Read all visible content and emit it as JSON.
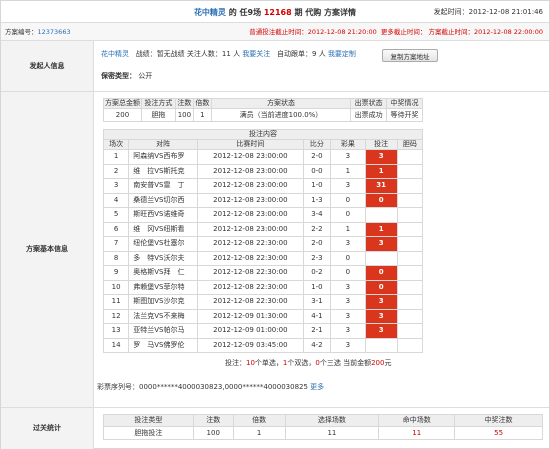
{
  "header": {
    "title_prefix": "花中精灵",
    "title_mid": " 的 任9场 ",
    "issue": "12168",
    "title_suffix": " 期 代购 方案详情",
    "publish_label": "发起时间：",
    "publish_time": "2012-12-08 21:01:46",
    "deadline_normal_label": "普通投注截止时间：",
    "deadline_normal": "2012-12-08 21:20:00",
    "deadline_more_label": "更多截止时间：",
    "deadline_final_label": "方案截止时间：",
    "deadline_final": "2012-12-08 22:00:00"
  },
  "scheme": {
    "id_label": "方案编号：",
    "id": "12373663"
  },
  "initiator": {
    "section_label": "发起人信息",
    "name": "花中精灵",
    "record_label": "战绩：",
    "record": "暂无战绩",
    "followers_label": " 关注人数：",
    "followers": "11",
    "followers_unit": " 人",
    "follow_link": "我要关注",
    "auto_label": "自动跟单：",
    "auto_count": "9",
    "auto_unit": " 人",
    "auto_link": "我要定制",
    "copy_button": "复制方案地址",
    "promo_label": "保密类型：",
    "promo_value": "公开"
  },
  "basic": {
    "section_label": "方案基本信息",
    "summary_headers": [
      "方案总金额",
      "投注方式",
      "注数",
      "倍数",
      "方案状态",
      "出票状态",
      "中奖情况"
    ],
    "summary_row": [
      "200",
      "胆拖",
      "100",
      "1",
      "满员（当前进度100.0%）",
      "出票成功",
      "等待开奖"
    ],
    "bet_title": "投注内容",
    "bet_headers": [
      "场次",
      "对阵",
      "比赛时间",
      "比分",
      "彩果",
      "投注",
      "胆码"
    ],
    "rows": [
      [
        "1",
        "阿森纳VS西布罗",
        "2012-12-08 23:00:00",
        "2-0",
        "3",
        "3",
        ""
      ],
      [
        "2",
        "维　拉VS斯托克",
        "2012-12-08 23:00:00",
        "0-0",
        "1",
        "1",
        ""
      ],
      [
        "3",
        "南安普VS雷　丁",
        "2012-12-08 23:00:00",
        "1-0",
        "3",
        "31",
        ""
      ],
      [
        "4",
        "桑德兰VS切尔西",
        "2012-12-08 23:00:00",
        "1-3",
        "0",
        "0",
        ""
      ],
      [
        "5",
        "斯旺西VS诺维奇",
        "2012-12-08 23:00:00",
        "3-4",
        "0",
        "",
        ""
      ],
      [
        "6",
        "维　冈VS纽斯看",
        "2012-12-08 23:00:00",
        "2-2",
        "1",
        "1",
        ""
      ],
      [
        "7",
        "纽伦堡VS杜塞尔",
        "2012-12-08 22:30:00",
        "2-0",
        "3",
        "3",
        ""
      ],
      [
        "8",
        "多　特VS沃尔夫",
        "2012-12-08 22:30:00",
        "2-3",
        "0",
        "",
        ""
      ],
      [
        "9",
        "奥格斯VS拜　仁",
        "2012-12-08 22:30:00",
        "0-2",
        "0",
        "0",
        ""
      ],
      [
        "10",
        "弗赖堡VS菲尔特",
        "2012-12-08 22:30:00",
        "1-0",
        "3",
        "0",
        ""
      ],
      [
        "11",
        "斯图加VS沙尔克",
        "2012-12-08 22:30:00",
        "3-1",
        "3",
        "3",
        ""
      ],
      [
        "12",
        "法兰克VS不来梅",
        "2012-12-09 01:30:00",
        "4-1",
        "3",
        "3",
        ""
      ],
      [
        "13",
        "亚特兰VS帕尔马",
        "2012-12-09 01:00:00",
        "2-1",
        "3",
        "3",
        ""
      ],
      [
        "14",
        "罗　马VS佛罗伦",
        "2012-12-09 03:45:00",
        "4-2",
        "3",
        "",
        ""
      ]
    ],
    "footer_prefix": "投注：",
    "single_count": "10",
    "footer_mid1": "个单选，",
    "double_count": "1",
    "footer_mid2": "个双选，",
    "triple_count": "0",
    "footer_mid3": "个三选 当前金额",
    "amount": "200",
    "footer_suffix": "元",
    "ticket_label": "彩票序列号：",
    "ticket_number": "0000******4000030823,0000******4000030825",
    "ticket_more": "更多"
  },
  "stats": {
    "section_label": "过关统计",
    "headers": [
      "投注类型",
      "注数",
      "倍数",
      "选择场数",
      "命中场数",
      "中奖注数"
    ],
    "row": [
      "胆拖投注",
      "100",
      "1",
      "11",
      "11",
      "55"
    ]
  },
  "colors": {
    "accent_red": "#d40000",
    "hit_cell": "#d9361d",
    "link_blue": "#2a6fb5"
  }
}
